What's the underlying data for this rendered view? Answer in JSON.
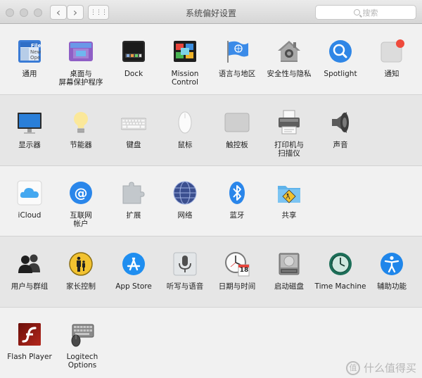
{
  "window": {
    "title": "系统偏好设置",
    "nav_back": "‹",
    "nav_forward": "›",
    "grid_glyph": "⋮⋮⋮"
  },
  "search": {
    "placeholder": "搜索"
  },
  "rows": [
    {
      "panes": [
        {
          "name": "general",
          "label": "通用",
          "icon": "general-icon"
        },
        {
          "name": "desktop-screensaver",
          "label": "桌面与\n屏幕保护程序",
          "icon": "desktop-icon"
        },
        {
          "name": "dock",
          "label": "Dock",
          "icon": "dock-icon"
        },
        {
          "name": "mission-control",
          "label": "Mission\nControl",
          "icon": "mission-control-icon"
        },
        {
          "name": "language-region",
          "label": "语言与地区",
          "icon": "flag-icon"
        },
        {
          "name": "security-privacy",
          "label": "安全性与隐私",
          "icon": "house-icon"
        },
        {
          "name": "spotlight",
          "label": "Spotlight",
          "icon": "spotlight-icon"
        },
        {
          "name": "notifications",
          "label": "通知",
          "icon": "notifications-icon"
        }
      ]
    },
    {
      "panes": [
        {
          "name": "displays",
          "label": "显示器",
          "icon": "display-icon"
        },
        {
          "name": "energy-saver",
          "label": "节能器",
          "icon": "lightbulb-icon"
        },
        {
          "name": "keyboard",
          "label": "键盘",
          "icon": "keyboard-icon"
        },
        {
          "name": "mouse",
          "label": "鼠标",
          "icon": "mouse-icon"
        },
        {
          "name": "trackpad",
          "label": "触控板",
          "icon": "trackpad-icon"
        },
        {
          "name": "printers-scanners",
          "label": "打印机与\n扫描仪",
          "icon": "printer-icon"
        },
        {
          "name": "sound",
          "label": "声音",
          "icon": "speaker-icon"
        }
      ]
    },
    {
      "panes": [
        {
          "name": "icloud",
          "label": "iCloud",
          "icon": "cloud-icon"
        },
        {
          "name": "internet-accounts",
          "label": "互联网\n帐户",
          "icon": "at-icon"
        },
        {
          "name": "extensions",
          "label": "扩展",
          "icon": "puzzle-icon"
        },
        {
          "name": "network",
          "label": "网络",
          "icon": "globe-icon"
        },
        {
          "name": "bluetooth",
          "label": "蓝牙",
          "icon": "bluetooth-icon"
        },
        {
          "name": "sharing",
          "label": "共享",
          "icon": "sharing-folder-icon"
        }
      ]
    },
    {
      "panes": [
        {
          "name": "users-groups",
          "label": "用户与群组",
          "icon": "users-icon"
        },
        {
          "name": "parental-controls",
          "label": "家长控制",
          "icon": "parental-icon"
        },
        {
          "name": "app-store",
          "label": "App Store",
          "icon": "app-store-icon"
        },
        {
          "name": "dictation-speech",
          "label": "听写与语音",
          "icon": "microphone-icon"
        },
        {
          "name": "date-time",
          "label": "日期与时间",
          "icon": "clock-icon",
          "day": "18"
        },
        {
          "name": "startup-disk",
          "label": "启动磁盘",
          "icon": "disk-icon"
        },
        {
          "name": "time-machine",
          "label": "Time Machine",
          "icon": "time-machine-icon"
        },
        {
          "name": "accessibility",
          "label": "辅助功能",
          "icon": "accessibility-icon"
        }
      ]
    },
    {
      "panes": [
        {
          "name": "flash-player",
          "label": "Flash Player",
          "icon": "flash-icon"
        },
        {
          "name": "logitech-options",
          "label": "Logitech Options",
          "icon": "logitech-icon"
        }
      ]
    }
  ],
  "general_icon_text": {
    "line1": "File",
    "line2": "New",
    "line3": "Ope"
  },
  "watermark": {
    "text": "什么值得买",
    "logo": "值"
  },
  "colors": {
    "accent": "#1f7ae6",
    "notification_dot": "#ef4a3c"
  }
}
